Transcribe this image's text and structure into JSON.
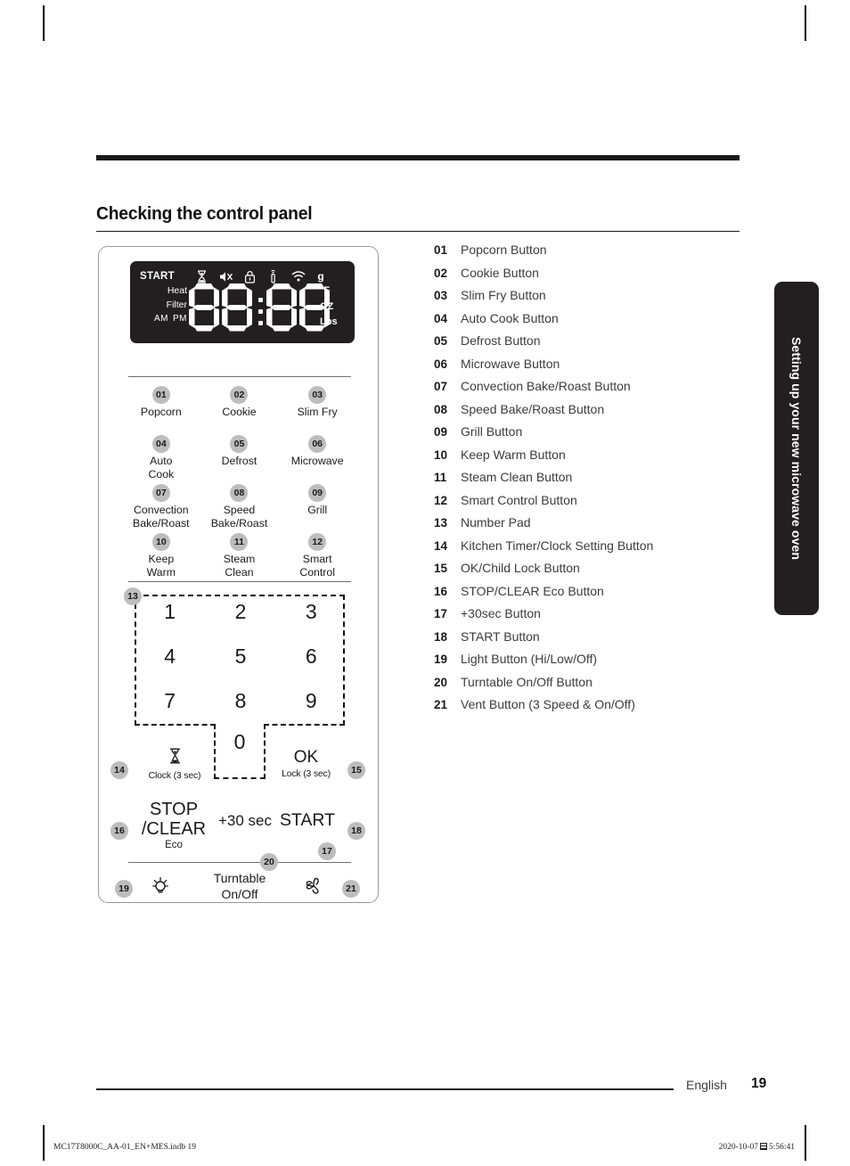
{
  "page": {
    "title": "Checking the control panel",
    "language": "English",
    "page_number": "19",
    "side_tab": "Setting up your new microwave oven",
    "print_left": "MC17T8000C_AA-01_EN+MES.indb   19",
    "print_date": "2020-10-07",
    "print_time": "5:56:41"
  },
  "display": {
    "start_label": "START",
    "icons": [
      "hourglass-icon",
      "mute-icon",
      "lock-icon",
      "probe-icon",
      "wifi-icon"
    ],
    "unit_g": "g",
    "left_labels": {
      "heat": "Heat",
      "filter": "Filter",
      "am": "AM",
      "pm": "PM"
    },
    "digits": [
      "8",
      "8",
      "8",
      "8"
    ],
    "right_labels": {
      "temp": "°F",
      "oz": "OZ",
      "lbs": "Lbs"
    }
  },
  "function_buttons": [
    {
      "num": "01",
      "label": "Popcorn"
    },
    {
      "num": "02",
      "label": "Cookie"
    },
    {
      "num": "03",
      "label": "Slim Fry"
    },
    {
      "num": "04",
      "label": "Auto\nCook"
    },
    {
      "num": "05",
      "label": "Defrost"
    },
    {
      "num": "06",
      "label": "Microwave"
    },
    {
      "num": "07",
      "label": "Convection\nBake/Roast"
    },
    {
      "num": "08",
      "label": "Speed\nBake/Roast"
    },
    {
      "num": "09",
      "label": "Grill"
    },
    {
      "num": "10",
      "label": "Keep\nWarm"
    },
    {
      "num": "11",
      "label": "Steam\nClean"
    },
    {
      "num": "12",
      "label": "Smart\nControl"
    }
  ],
  "number_pad": {
    "badge": "13",
    "keys": [
      "1",
      "2",
      "3",
      "4",
      "5",
      "6",
      "7",
      "8",
      "9"
    ],
    "zero": "0"
  },
  "controls": {
    "clock": {
      "badge": "14",
      "sub": "Clock (3 sec)"
    },
    "ok": {
      "badge": "15",
      "main": "OK",
      "sub": "Lock (3 sec)"
    },
    "stop": {
      "badge": "16",
      "line1": "STOP",
      "line2": "/CLEAR",
      "sub": "Eco"
    },
    "plus30": {
      "badge": "17",
      "label": "+30 sec"
    },
    "start": {
      "badge": "18",
      "label": "START"
    },
    "light": {
      "badge": "19"
    },
    "turntable": {
      "badge": "20",
      "label": "Turntable\nOn/Off"
    },
    "vent": {
      "badge": "21"
    }
  },
  "legend": [
    {
      "num": "01",
      "text": "Popcorn Button"
    },
    {
      "num": "02",
      "text": "Cookie Button"
    },
    {
      "num": "03",
      "text": "Slim Fry Button"
    },
    {
      "num": "04",
      "text": "Auto Cook Button"
    },
    {
      "num": "05",
      "text": "Defrost Button"
    },
    {
      "num": "06",
      "text": "Microwave Button"
    },
    {
      "num": "07",
      "text": "Convection Bake/Roast Button"
    },
    {
      "num": "08",
      "text": "Speed Bake/Roast Button"
    },
    {
      "num": "09",
      "text": "Grill Button"
    },
    {
      "num": "10",
      "text": "Keep Warm Button"
    },
    {
      "num": "11",
      "text": "Steam Clean Button"
    },
    {
      "num": "12",
      "text": "Smart Control Button"
    },
    {
      "num": "13",
      "text": "Number Pad"
    },
    {
      "num": "14",
      "text": "Kitchen Timer/Clock Setting Button"
    },
    {
      "num": "15",
      "text": "OK/Child Lock Button"
    },
    {
      "num": "16",
      "text": "STOP/CLEAR Eco Button"
    },
    {
      "num": "17",
      "text": "+30sec Button"
    },
    {
      "num": "18",
      "text": "START Button"
    },
    {
      "num": "19",
      "text": "Light Button (Hi/Low/Off)"
    },
    {
      "num": "20",
      "text": "Turntable On/Off Button"
    },
    {
      "num": "21",
      "text": "Vent Button (3 Speed & On/Off)"
    }
  ],
  "colors": {
    "badge_gray": "#bdbdbd",
    "display_black": "#231f20",
    "text_dark": "#1a1a1a",
    "legend_text": "#3c3c3c"
  }
}
